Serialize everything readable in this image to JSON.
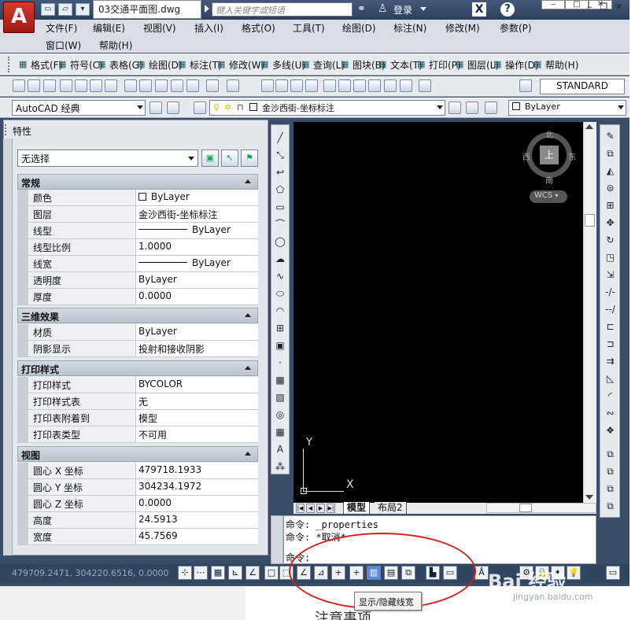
{
  "app": {
    "logo": "A",
    "doc_tab": "03交通平面图.dwg",
    "search_placeholder": "键入关键字或短语",
    "login": "登录",
    "help": "?",
    "x": "X"
  },
  "menu_row1": [
    "文件(F)",
    "编辑(E)",
    "视图(V)",
    "插入(I)",
    "格式(O)",
    "工具(T)",
    "绘图(D)",
    "标注(N)",
    "修改(M)",
    "参数(P)"
  ],
  "menu_row2": [
    "窗口(W)",
    "帮助(H)"
  ],
  "express_menu": [
    "格式(F)",
    "符号(C)",
    "表格(G)",
    "绘图(D)",
    "标注(T)",
    "修改(W)",
    "多线(U)",
    "查询(L)",
    "图块(B)",
    "文本(T)",
    "打印(P)",
    "图层(L)",
    "操作(D)",
    "帮助(H)"
  ],
  "text_style": "STANDARD",
  "workspace": "AutoCAD 经典",
  "layer_current": "金沙西街-坐标标注",
  "color_current": "ByLayer",
  "palette": {
    "title": "特性",
    "selection": "无选择",
    "sections": [
      {
        "title": "常规",
        "rows": [
          {
            "k": "颜色",
            "v": "ByLayer",
            "type": "swatch"
          },
          {
            "k": "图层",
            "v": "金沙西街-坐标标注"
          },
          {
            "k": "线型",
            "v": "ByLayer",
            "type": "line"
          },
          {
            "k": "线型比例",
            "v": "1.0000"
          },
          {
            "k": "线宽",
            "v": "ByLayer",
            "type": "line"
          },
          {
            "k": "透明度",
            "v": "ByLayer"
          },
          {
            "k": "厚度",
            "v": "0.0000"
          }
        ]
      },
      {
        "title": "三维效果",
        "rows": [
          {
            "k": "材质",
            "v": "ByLayer"
          },
          {
            "k": "阴影显示",
            "v": "投射和接收阴影"
          }
        ]
      },
      {
        "title": "打印样式",
        "rows": [
          {
            "k": "打印样式",
            "v": "BYCOLOR"
          },
          {
            "k": "打印样式表",
            "v": "无"
          },
          {
            "k": "打印表附着到",
            "v": "模型"
          },
          {
            "k": "打印表类型",
            "v": "不可用"
          }
        ]
      },
      {
        "title": "视图",
        "rows": [
          {
            "k": "圆心 X 坐标",
            "v": "479718.1933"
          },
          {
            "k": "圆心 Y 坐标",
            "v": "304234.1972"
          },
          {
            "k": "圆心 Z 坐标",
            "v": "0.0000"
          },
          {
            "k": "高度",
            "v": "24.5913"
          },
          {
            "k": "宽度",
            "v": "45.7569"
          }
        ]
      }
    ]
  },
  "viewcube": {
    "north": "北",
    "south": "南",
    "east": "东",
    "west": "西",
    "face": "上",
    "wcs": "WCS"
  },
  "ucs": {
    "x": "X",
    "y": "Y"
  },
  "layout_tabs": [
    "模型",
    "布局2"
  ],
  "command_lines": [
    "命令: _properties",
    "命令: *取消*",
    "命令:"
  ],
  "coords": "479709.2471, 304220.6516, 0.0000",
  "tooltip": "显示/隐藏线宽",
  "caption": "注意事项",
  "watermark": "Bai 经验",
  "watermark_url": "jingyan.baidu.com"
}
